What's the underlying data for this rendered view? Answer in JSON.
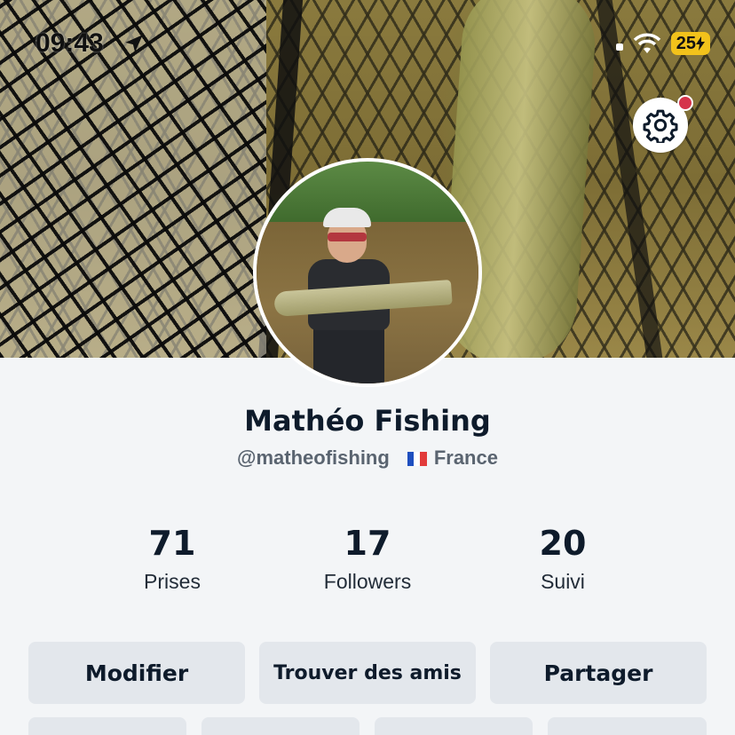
{
  "status_bar": {
    "time": "09:43",
    "battery": "25"
  },
  "profile": {
    "name": "Mathéo Fishing",
    "handle": "@matheofishing",
    "country": "France"
  },
  "stats": [
    {
      "value": "71",
      "label": "Prises"
    },
    {
      "value": "17",
      "label": "Followers"
    },
    {
      "value": "20",
      "label": "Suivi"
    }
  ],
  "actions": {
    "edit_label": "Modifier",
    "find_friends_label": "Trouver des amis",
    "share_label": "Partager"
  },
  "icons": {
    "settings": "gear-icon",
    "location": "location-arrow-icon",
    "wifi": "wifi-icon",
    "notification": "notification-dot"
  },
  "colors": {
    "notification_dot": "#d5344b",
    "battery": "#f2c21b",
    "button_bg": "#e3e7ec",
    "text_primary": "#0e1b2b"
  }
}
